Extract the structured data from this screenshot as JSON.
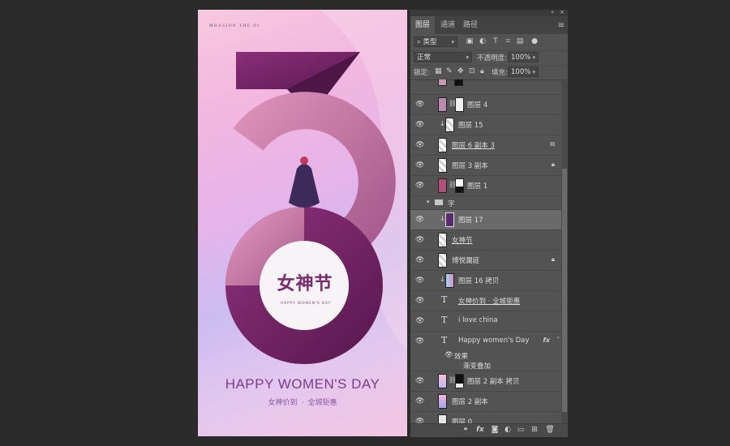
{
  "poster": {
    "brand": "MRASION THE OJ",
    "logo_zh": "女神节",
    "logo_en": "HAPPY WOMEN'S DAY",
    "headline": "HAPPY WOMEN'S DAY",
    "sub_left": "女神价到",
    "sub_dot": "·",
    "sub_right": "全城钜惠"
  },
  "panel": {
    "tabs": [
      {
        "label": "图层",
        "active": true
      },
      {
        "label": "通道",
        "active": false
      },
      {
        "label": "路径",
        "active": false
      }
    ],
    "top_buttons": [
      "«",
      "×"
    ],
    "filter_kind": "类型",
    "blend_mode": "正常",
    "opacity_label": "不透明度:",
    "opacity_value": "100%",
    "lock_label": "锁定:",
    "fill_label": "填充:",
    "fill_value": "100%",
    "layers": [
      {
        "name": "图层 4"
      },
      {
        "name": "图层 15"
      },
      {
        "name": "图层 6 副本 3"
      },
      {
        "name": "图层 3 副本"
      },
      {
        "name": "图层 1"
      },
      {
        "name": "字"
      },
      {
        "name": "图层 17"
      },
      {
        "name": "女神节"
      },
      {
        "name": "博悦瀾庭"
      },
      {
        "name": "图层 16 拷贝"
      },
      {
        "name": "女神价到 · 全城钜惠"
      },
      {
        "name": "i love china"
      },
      {
        "name": "Happy women's Day"
      },
      {
        "name": "图层 2 副本 拷贝"
      },
      {
        "name": "图层 2 副本"
      },
      {
        "name": "图层 0"
      }
    ],
    "effects_label": "效果",
    "gradient_overlay_label": "渐变叠加",
    "fx_label": "fx"
  },
  "colors": {
    "workspace": "#2b2b2b",
    "panel": "#535353",
    "selected_row": "#6a6a6a",
    "poster_plum": "#7a2a68",
    "poster_pink": "#c77fa6"
  }
}
